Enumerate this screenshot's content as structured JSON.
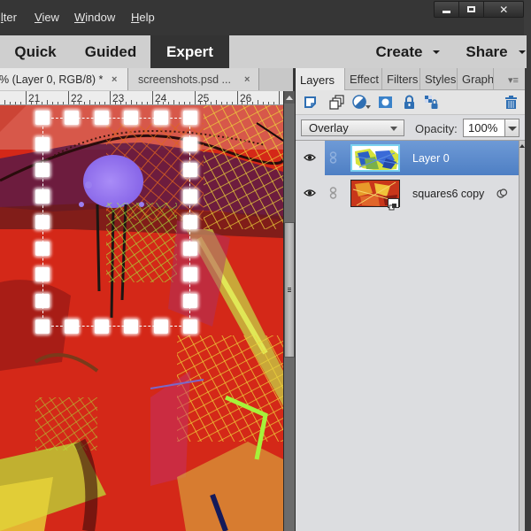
{
  "menubar": {
    "items": [
      {
        "label": "ilter",
        "mnemonic_index": 1
      },
      {
        "label": "View",
        "mnemonic_index": 0
      },
      {
        "label": "Window",
        "mnemonic_index": 0
      },
      {
        "label": "Help",
        "mnemonic_index": 0
      }
    ],
    "window_controls": [
      "minimize",
      "maximize",
      "close"
    ],
    "close_glyph": "✕"
  },
  "modebar": {
    "tabs": [
      {
        "label": "Quick",
        "active": false
      },
      {
        "label": "Guided",
        "active": false
      },
      {
        "label": "Expert",
        "active": true
      }
    ],
    "create_label": "Create",
    "share_label": "Share"
  },
  "document_tabs": [
    {
      "label": "% (Layer 0, RGB/8) *",
      "active": true,
      "close": "×"
    },
    {
      "label": "screenshots.psd ...",
      "active": false,
      "close": "×"
    }
  ],
  "ruler": {
    "unit_labels": [
      "21",
      "22",
      "23",
      "24",
      "25",
      "26"
    ]
  },
  "canvas": {
    "description": "abstract red artwork with purple splash, yellow-green grid strokes",
    "selection": "dashed rectangular marquee with transform handles",
    "colors": {
      "base_red": "#d7271a",
      "purple_splash": "#9b7cf2",
      "yellow_grid": "#e8d23a",
      "lime": "#a6f23a",
      "dark_band": "#5a1836"
    }
  },
  "panel": {
    "tabs": [
      {
        "label": "Layers",
        "active": true
      },
      {
        "label": "Effect",
        "active": false
      },
      {
        "label": "Filters",
        "active": false
      },
      {
        "label": "Styles",
        "active": false
      },
      {
        "label": "Graph",
        "active": false
      }
    ],
    "menu_glyph": "▾≡",
    "toolbar_icons": [
      "new-layer-icon",
      "new-group-icon",
      "adjustment-layer-icon",
      "layer-mask-icon",
      "lock-all-icon",
      "lock-transparency-icon",
      "delete-layer-icon"
    ],
    "blend_mode": "Overlay",
    "opacity_label": "Opacity:",
    "opacity_value": "100%",
    "layers": [
      {
        "name": "Layer 0",
        "selected": true,
        "visible": true,
        "smart_object": false
      },
      {
        "name": "squares6 copy",
        "selected": false,
        "visible": true,
        "smart_object": true
      }
    ]
  },
  "colors": {
    "menubar_bg": "#363636",
    "modebar_bg": "#cfcfcf",
    "active_mode_bg": "#333333",
    "panel_bg": "#dcdde0",
    "selected_layer": "#5b89cc",
    "icon_blue": "#2f6fb3"
  }
}
